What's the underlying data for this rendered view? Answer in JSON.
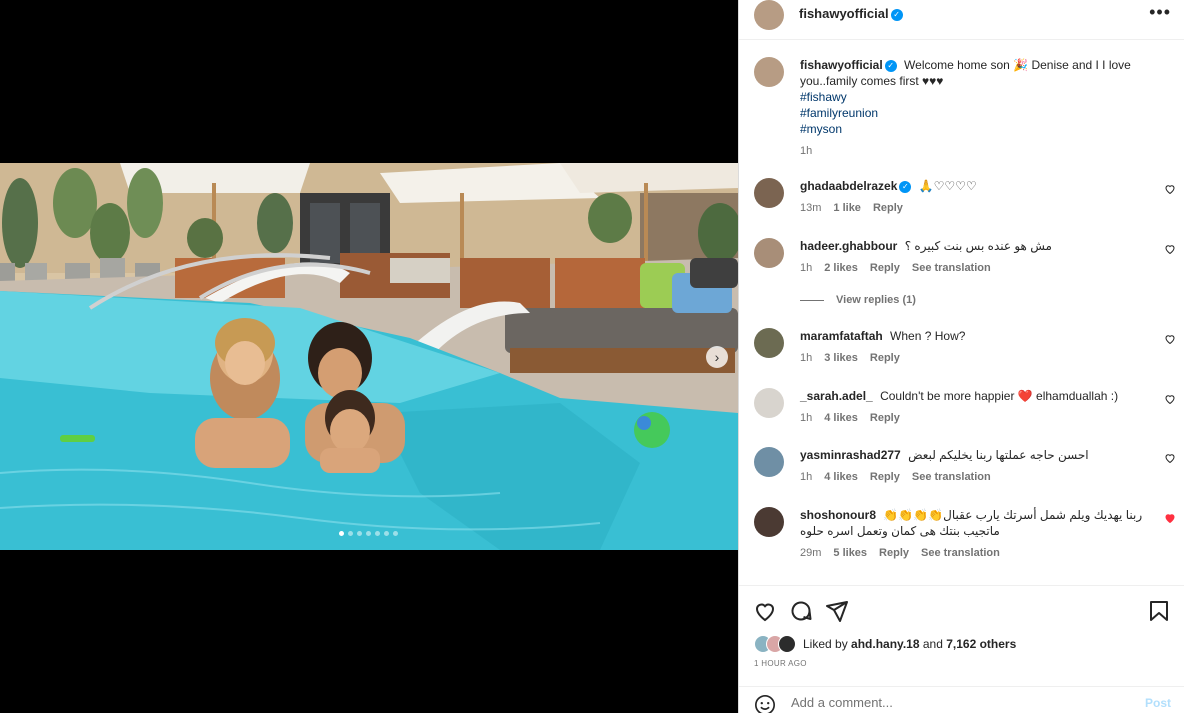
{
  "post": {
    "author": "fishawyofficial",
    "verified_icon": "verified-badge-icon",
    "more_icon": "more-options-icon",
    "caption": {
      "text": "Welcome home son 🎉 Denise and I I love you..family comes first ♥♥♥",
      "hashtags": [
        "#fishawy",
        "#familyreunion",
        "#myson"
      ],
      "time": "1h"
    }
  },
  "media": {
    "carousel_count": 7,
    "active_index": 0,
    "next_icon": "chevron-right-icon"
  },
  "comments": [
    {
      "user": "ghadaabdelrazek",
      "verified": true,
      "text": "🙏♡♡♡♡",
      "time": "13m",
      "likes": "1 like",
      "reply": "Reply",
      "liked": false
    },
    {
      "user": "hadeer.ghabbour",
      "verified": false,
      "text": "مش هو عنده بس بنت كبيره ؟",
      "time": "1h",
      "likes": "2 likes",
      "reply": "Reply",
      "translate": "See translation",
      "view_replies": "View replies (1)",
      "liked": false
    },
    {
      "user": "maramfataftah",
      "verified": false,
      "text": "When ? How?",
      "time": "1h",
      "likes": "3 likes",
      "reply": "Reply",
      "liked": false
    },
    {
      "user": "_sarah.adel_",
      "verified": false,
      "text": "Couldn't be more happier ❤️ elhamduallah :)",
      "time": "1h",
      "likes": "4 likes",
      "reply": "Reply",
      "liked": false
    },
    {
      "user": "yasminrashad277",
      "verified": false,
      "text": "احسن حاجه عملتها ربنا يخليكم لبعض",
      "time": "1h",
      "likes": "4 likes",
      "reply": "Reply",
      "translate": "See translation",
      "liked": false
    },
    {
      "user": "shoshonour8",
      "verified": false,
      "text": "ربنا يهديك ويلم شمل أسرتك يارب عقبال👏👏👏👏 ماتجيب بنتك هى كمان وتعمل اسره حلوه",
      "time": "29m",
      "likes": "5 likes",
      "reply": "Reply",
      "translate": "See translation",
      "liked": true
    }
  ],
  "actions": {
    "like_icon": "heart-icon",
    "comment_icon": "comment-icon",
    "share_icon": "share-icon",
    "save_icon": "bookmark-icon",
    "liked_by_prefix": "Liked by",
    "liked_by_user": "ahd.hany.18",
    "liked_by_and": "and",
    "liked_by_others": "7,162 others",
    "time_ago": "1 HOUR AGO"
  },
  "comment_box": {
    "emoji_icon": "emoji-icon",
    "placeholder": "Add a comment...",
    "value": "",
    "post_label": "Post"
  },
  "colors": {
    "verified": "#0095f6",
    "liked_heart": "#ff3040",
    "link": "#00376b",
    "post_disabled": "#b2dffc"
  }
}
